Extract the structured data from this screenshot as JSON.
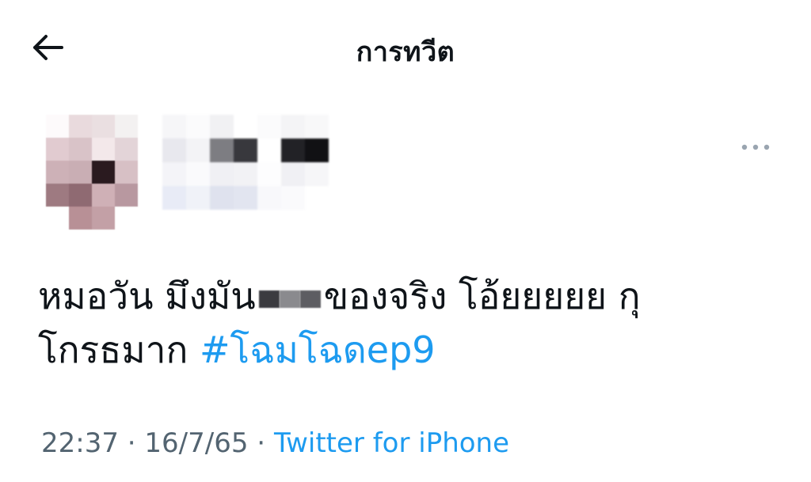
{
  "header": {
    "title": "การทวีต",
    "back_icon": "arrow-left-icon"
  },
  "tweet": {
    "author_avatar": "pixelated-avatar",
    "author_name_hidden": true,
    "more_icon": "more-horizontal-icon",
    "text_part1": "หมอวัน มึงมัน",
    "text_part2": "ของจริง โอ้ยยยยย กุ",
    "text_part3": "โกรธมาก ",
    "hashtag": "#โฉมโฉดep9",
    "time": "22:37",
    "separator": " · ",
    "date": "16/7/65",
    "source": "Twitter for iPhone"
  },
  "colors": {
    "text": "#0f1419",
    "secondary": "#536471",
    "link": "#1d9bf0"
  }
}
